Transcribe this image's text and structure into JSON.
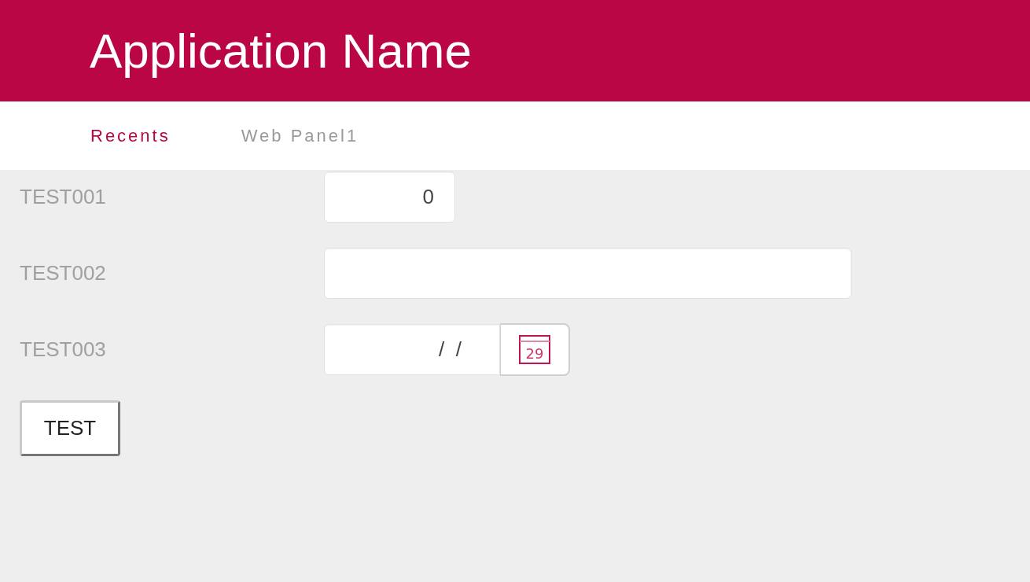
{
  "header": {
    "title": "Application Name"
  },
  "tabs": [
    {
      "label": "Recents",
      "selected": true
    },
    {
      "label": "Web Panel1",
      "selected": false
    }
  ],
  "fields": [
    {
      "label": "TEST001",
      "kind": "number",
      "value": "0"
    },
    {
      "label": "TEST002",
      "kind": "text"
    },
    {
      "label": "TEST003",
      "kind": "date",
      "value": "  /  /",
      "calendar_day": "29"
    }
  ],
  "button": {
    "label": "TEST"
  }
}
